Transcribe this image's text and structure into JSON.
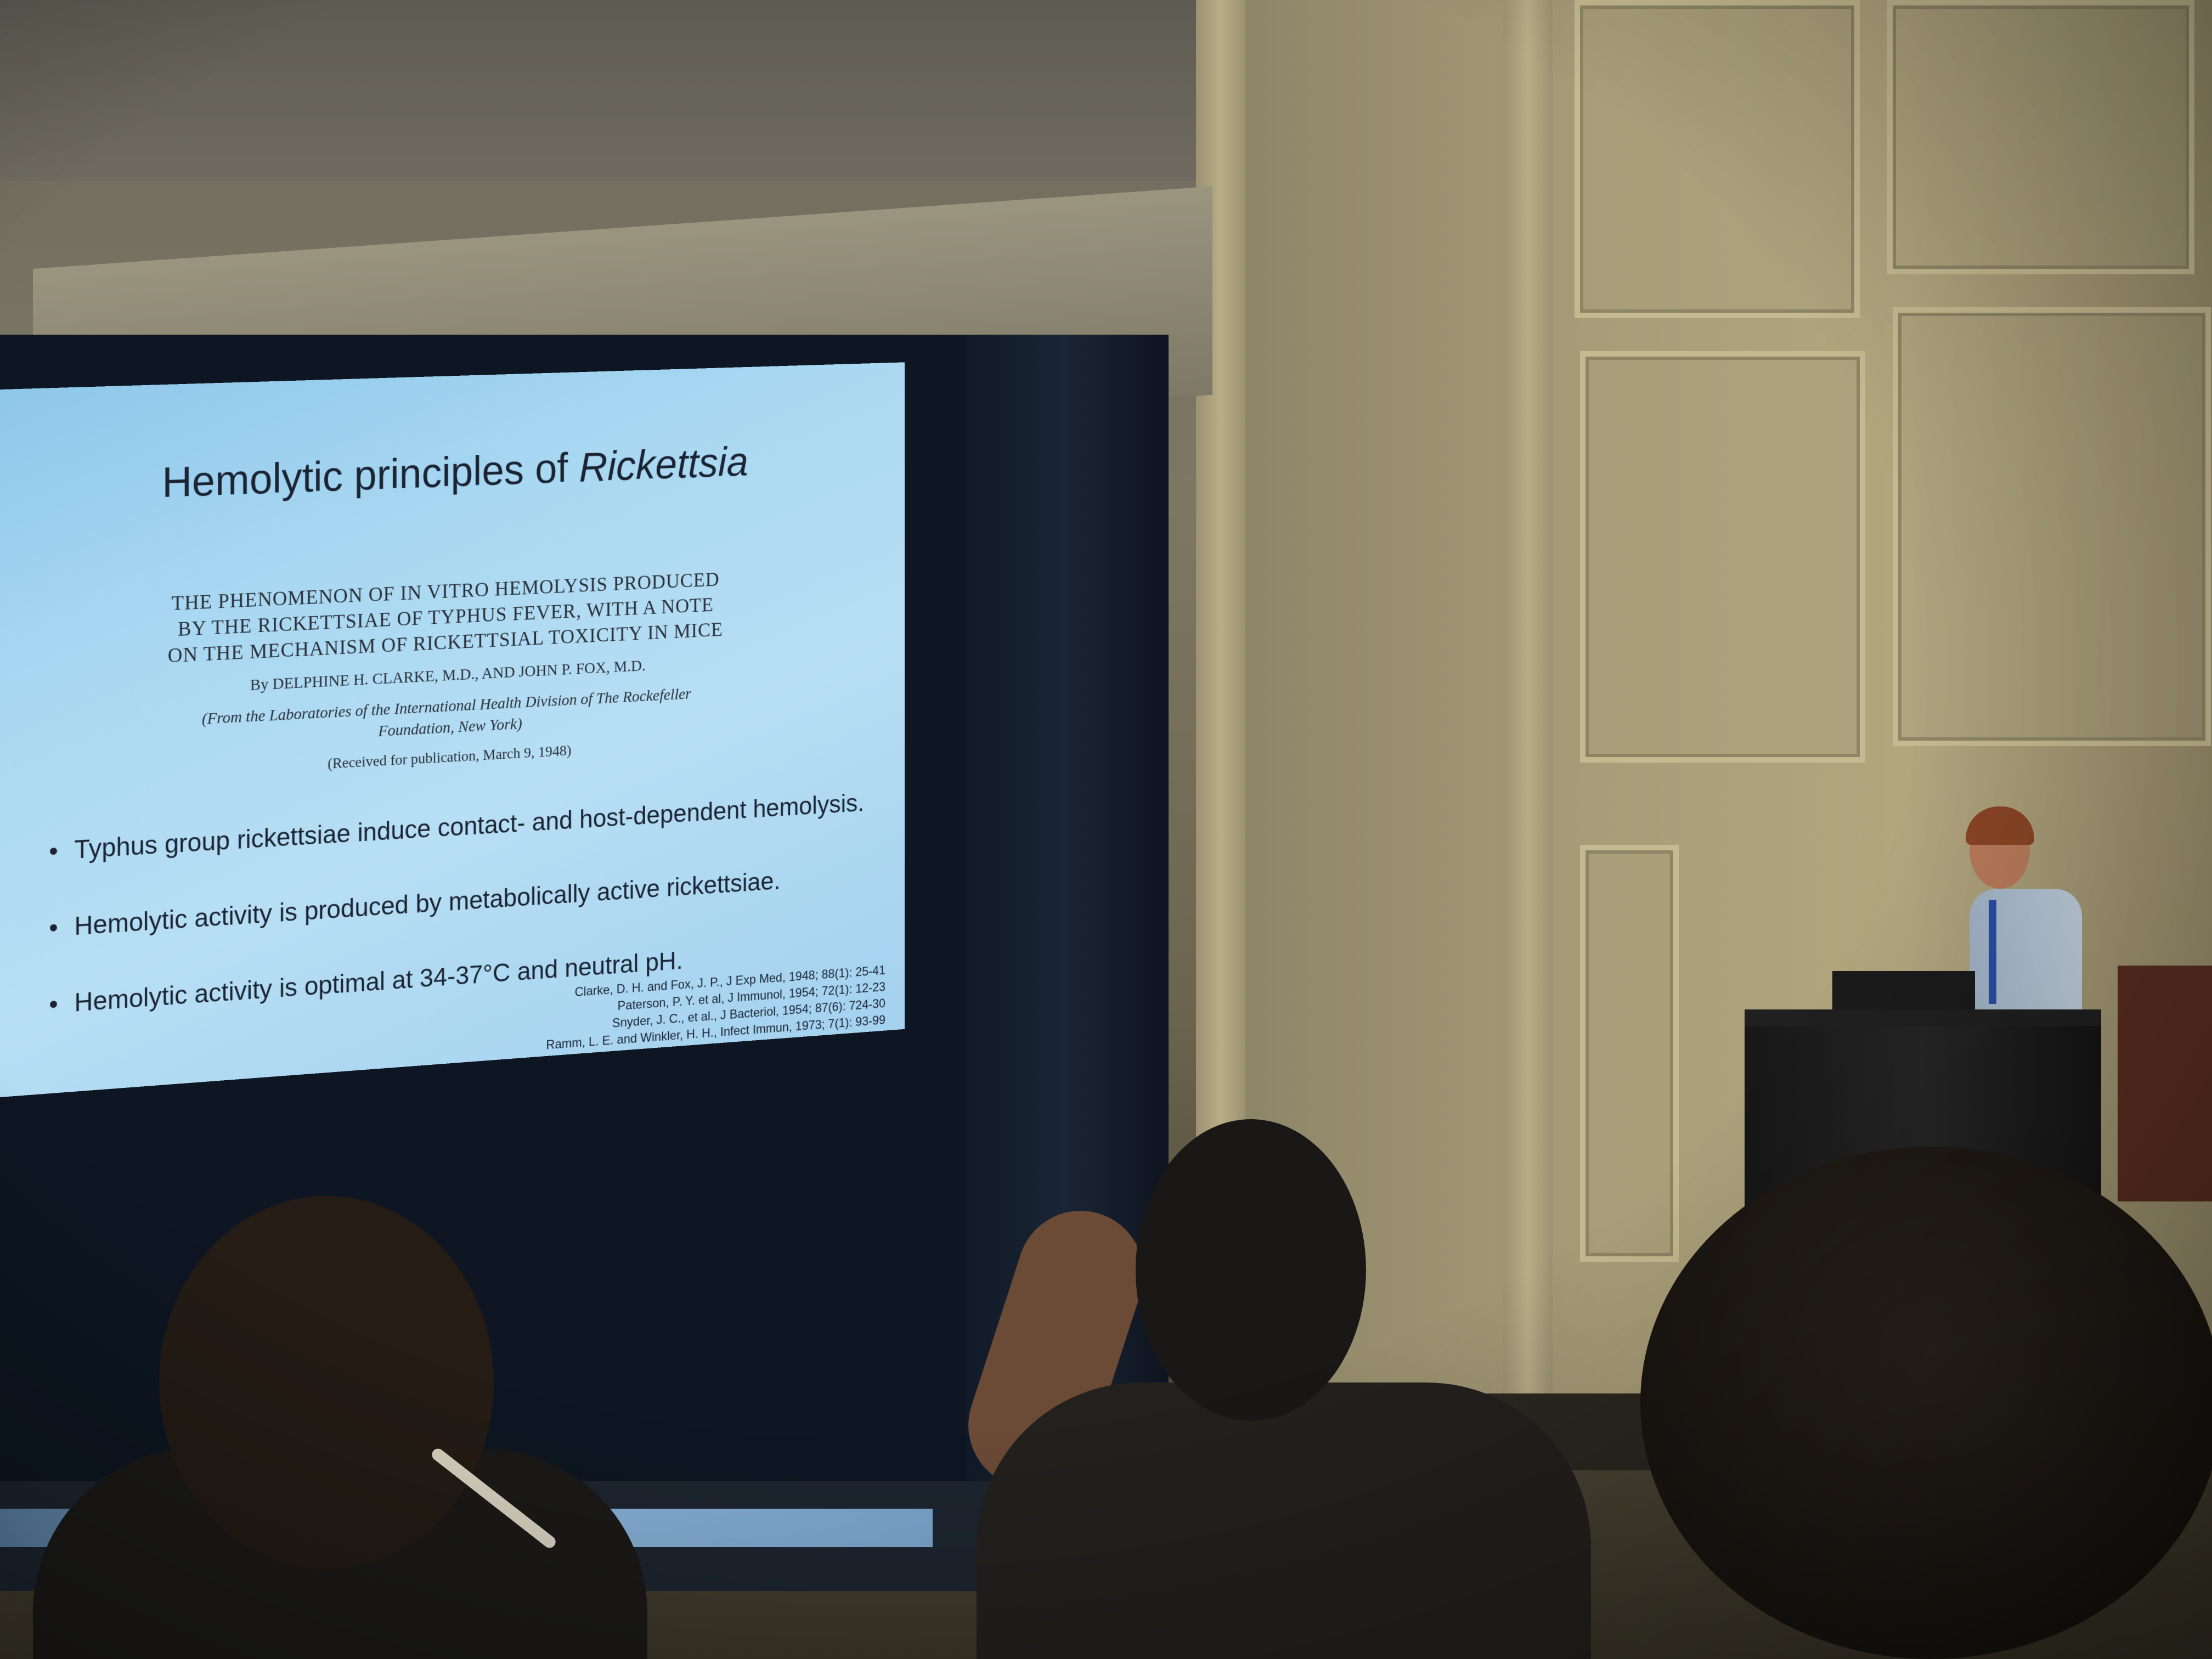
{
  "slide": {
    "title_prefix": "Hemolytic principles of ",
    "title_italic": "Rickettsia",
    "paper": {
      "title": "THE PHENOMENON OF IN VITRO HEMOLYSIS PRODUCED BY THE RICKETTSIAE OF TYPHUS FEVER, WITH A NOTE ON THE MECHANISM OF RICKETTSIAL TOXICITY IN MICE",
      "authors": "By DELPHINE H. CLARKE, M.D., AND JOHN P. FOX, M.D.",
      "affiliation": "(From the Laboratories of the International Health Division of The Rockefeller Foundation, New York)",
      "received": "(Received for publication, March 9, 1948)"
    },
    "bullets": [
      "Typhus group rickettsiae induce contact- and host-dependent hemolysis.",
      "Hemolytic activity is produced by metabolically active rickettsiae.",
      "Hemolytic activity is optimal at 34-37°C and neutral pH."
    ],
    "references": [
      "Clarke, D. H. and Fox, J. P., J Exp Med, 1948; 88(1): 25-41",
      "Paterson, P. Y. et al, J Immunol, 1954; 72(1): 12-23",
      "Snyder, J. C., et al., J Bacteriol, 1954; 87(6): 724-30",
      "Ramm, L. E. and Winkler, H. H., Infect Immun, 1973; 7(1): 93-99"
    ]
  }
}
